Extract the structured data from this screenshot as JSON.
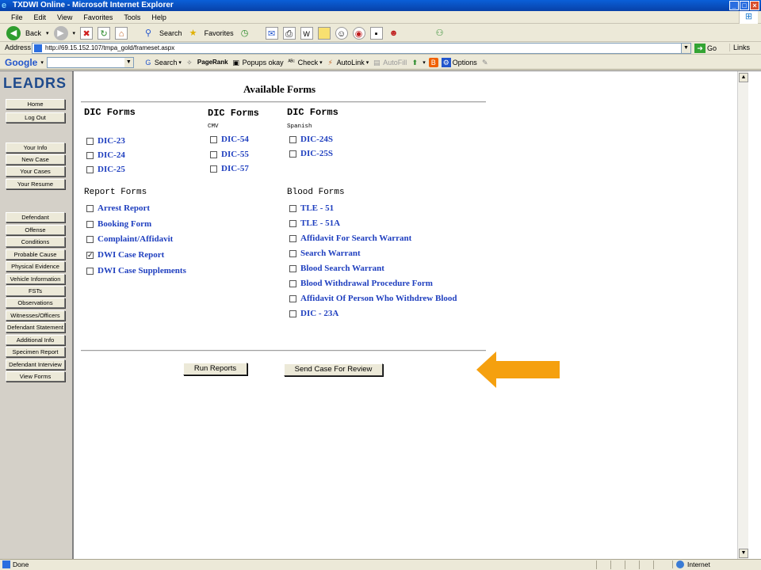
{
  "window": {
    "title": "TXDWI Online - Microsoft Internet Explorer",
    "controls": [
      "_",
      "□",
      "×"
    ]
  },
  "menu": [
    "File",
    "Edit",
    "View",
    "Favorites",
    "Tools",
    "Help"
  ],
  "toolbar": {
    "back": "Back",
    "search": "Search",
    "favorites": "Favorites"
  },
  "address": {
    "label": "Address",
    "url": "http://69.15.152.107/tmpa_gold/frameset.aspx",
    "go": "Go",
    "links": "Links"
  },
  "google_bar": {
    "logo": "Google",
    "search": "Search",
    "pagerank": "PageRank",
    "popups": "Popups okay",
    "check": "Check",
    "autolink": "AutoLink",
    "autofill": "AutoFill",
    "options": "Options"
  },
  "sidebar": {
    "logo": "LEADRS",
    "buttons": [
      "Home",
      "Log Out",
      "Your Info",
      "New Case",
      "Your Cases",
      "Your Resume",
      "Defendant",
      "Offense",
      "Conditions",
      "Probable Cause",
      "Physical Evidence",
      "Vehicle Information",
      "FSTs",
      "Observations",
      "Witnesses/Officers",
      "Defendant Statement",
      "Additional Info",
      "Specimen Report",
      "Defendant Interview",
      "View Forms"
    ]
  },
  "main": {
    "heading": "Available Forms",
    "dic_forms": {
      "title": "DIC Forms",
      "items": [
        {
          "label": "DIC-23",
          "checked": false
        },
        {
          "label": "DIC-24",
          "checked": false
        },
        {
          "label": "DIC-25",
          "checked": false
        }
      ]
    },
    "dic_cmv": {
      "title": "DIC Forms",
      "subtitle": "CMV",
      "items": [
        {
          "label": "DIC-54",
          "checked": false
        },
        {
          "label": "DIC-55",
          "checked": false
        },
        {
          "label": "DIC-57",
          "checked": false
        }
      ]
    },
    "dic_spanish": {
      "title": "DIC Forms",
      "subtitle": "Spanish",
      "items": [
        {
          "label": "DIC-24S",
          "checked": false
        },
        {
          "label": "DIC-25S",
          "checked": false
        }
      ]
    },
    "report_forms": {
      "title": "Report Forms",
      "items": [
        {
          "label": "Arrest Report",
          "checked": false
        },
        {
          "label": "Booking Form",
          "checked": false
        },
        {
          "label": "Complaint/Affidavit",
          "checked": false
        },
        {
          "label": "DWI Case Report",
          "checked": true
        },
        {
          "label": "DWI Case Supplements",
          "checked": false
        }
      ]
    },
    "blood_forms": {
      "title": "Blood Forms",
      "items": [
        {
          "label": "TLE - 51",
          "checked": false
        },
        {
          "label": "TLE - 51A",
          "checked": false
        },
        {
          "label": "Affidavit For Search Warrant",
          "checked": false
        },
        {
          "label": "Search Warrant",
          "checked": false
        },
        {
          "label": "Blood Search Warrant",
          "checked": false
        },
        {
          "label": "Blood Withdrawal Procedure Form",
          "checked": false
        },
        {
          "label": "Affidavit Of Person Who Withdrew Blood",
          "checked": false
        },
        {
          "label": "DIC - 23A",
          "checked": false
        }
      ]
    },
    "run_reports": "Run Reports",
    "send_case": "Send Case For Review"
  },
  "status": {
    "text": "Done",
    "zone": "Internet"
  },
  "colors": {
    "link": "#1f3fbf",
    "arrow": "#f5a00f",
    "logo": "#1e4a8c"
  }
}
